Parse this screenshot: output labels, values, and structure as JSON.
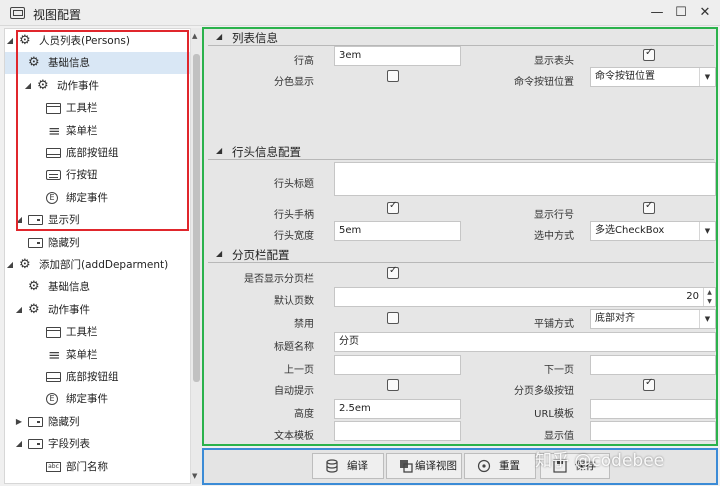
{
  "window": {
    "title": "视图配置",
    "minimize": "—",
    "maximize": "☐",
    "close": "✕"
  },
  "tree": {
    "items": [
      {
        "label": "人员列表(Persons)",
        "icon": "gears-icon",
        "arrow": "◢"
      },
      {
        "label": "基础信息",
        "icon": "gear-icon",
        "arrow": ""
      },
      {
        "label": "动作事件",
        "icon": "gears-icon",
        "arrow": "◢"
      },
      {
        "label": "工具栏",
        "icon": "window-icon",
        "arrow": ""
      },
      {
        "label": "菜单栏",
        "icon": "menu-icon",
        "arrow": ""
      },
      {
        "label": "底部按钮组",
        "icon": "bottom-bar-icon",
        "arrow": ""
      },
      {
        "label": "行按钮",
        "icon": "row-button-icon",
        "arrow": ""
      },
      {
        "label": "绑定事件",
        "icon": "event-icon",
        "arrow": ""
      },
      {
        "label": "显示列",
        "icon": "column-icon",
        "arrow": "◢"
      },
      {
        "label": "隐藏列",
        "icon": "column-icon",
        "arrow": ""
      },
      {
        "label": "添加部门(addDeparment)",
        "icon": "gears-icon",
        "arrow": "◢"
      },
      {
        "label": "基础信息",
        "icon": "gear-icon",
        "arrow": ""
      },
      {
        "label": "动作事件",
        "icon": "gears-icon",
        "arrow": "◢"
      },
      {
        "label": "工具栏",
        "icon": "window-icon",
        "arrow": ""
      },
      {
        "label": "菜单栏",
        "icon": "menu-icon",
        "arrow": ""
      },
      {
        "label": "底部按钮组",
        "icon": "bottom-bar-icon",
        "arrow": ""
      },
      {
        "label": "绑定事件",
        "icon": "event-icon",
        "arrow": ""
      },
      {
        "label": "隐藏列",
        "icon": "column-icon",
        "arrow": "▶"
      },
      {
        "label": "字段列表",
        "icon": "column-icon",
        "arrow": "◢"
      },
      {
        "label": "部门名称",
        "icon": "text-field-icon",
        "arrow": ""
      }
    ]
  },
  "sections": {
    "list": {
      "title": "列表信息",
      "row_height_label": "行高",
      "row_height_value": "3em",
      "show_header_label": "显示表头",
      "stripe_label": "分色显示",
      "cmd_position_label": "命令按钮位置",
      "cmd_position_value": "命令按钮位置"
    },
    "header": {
      "title": "行头信息配置",
      "header_title_label": "行头标题",
      "header_title_value": "",
      "handle_label": "行头手柄",
      "show_row_num_label": "显示行号",
      "width_label": "行头宽度",
      "width_value": "5em",
      "select_mode_label": "选中方式",
      "select_mode_value": "多选CheckBox"
    },
    "pager": {
      "title": "分页栏配置",
      "show_pager_label": "是否显示分页栏",
      "page_size_label": "默认页数",
      "page_size_value": "20",
      "disabled_label": "禁用",
      "tile_label": "平铺方式",
      "tile_value": "底部对齐",
      "caption_label": "标题名称",
      "caption_value": "分页",
      "prev_label": "上一页",
      "prev_value": "",
      "next_label": "下一页",
      "next_value": "",
      "auto_tip_label": "自动提示",
      "multi_btn_label": "分页多级按钮",
      "height_label": "高度",
      "height_value": "2.5em",
      "url_tpl_label": "URL模板",
      "url_tpl_value": "",
      "text_tpl_label": "文本模板",
      "text_tpl_value": "",
      "display_value_label": "显示值",
      "display_value_value": ""
    }
  },
  "checkboxes": {
    "show_header": true,
    "stripe": false,
    "handle": true,
    "show_row_num": true,
    "show_pager": true,
    "disabled": false,
    "auto_tip": false,
    "multi_btn": true
  },
  "toolbar": {
    "compile": "编译",
    "compile_view": "编译视图",
    "reset": "重置",
    "save": "保存"
  },
  "watermark": "知乎 @codebee",
  "colors": {
    "red_box": "#e0262c",
    "green_box": "#2bb24c",
    "blue_box": "#3b8bd6",
    "selected_row": "#d9e7f5"
  }
}
